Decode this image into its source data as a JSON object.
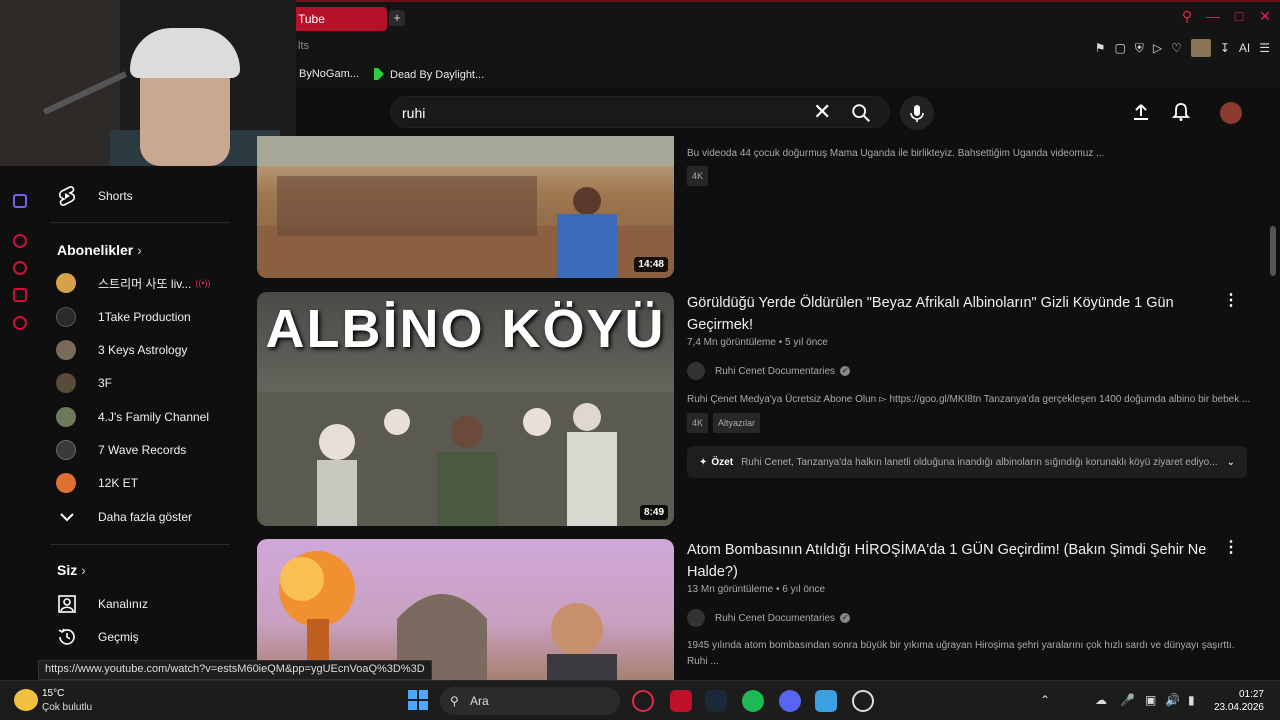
{
  "browser": {
    "tab_title": "Tube",
    "address_partial": "lts",
    "bookmarks": [
      "ByNoGam...",
      "Dead By Daylight..."
    ],
    "ai_label": "AI"
  },
  "youtube": {
    "search_value": "ruhi"
  },
  "sidebar": {
    "shorts_label": "Shorts",
    "subscriptions_header": "Abonelikler",
    "channels": [
      {
        "name": "스트리머 사또 liv...",
        "live": true,
        "color": "#d4a24a"
      },
      {
        "name": "1Take Production",
        "live": false,
        "color": "#2a2a2a"
      },
      {
        "name": "3 Keys Astrology",
        "live": false,
        "color": "#7a6a5a"
      },
      {
        "name": "3F",
        "live": false,
        "color": "#5a4a3a"
      },
      {
        "name": "4.J's Family Channel",
        "live": false,
        "color": "#6a7a5a"
      },
      {
        "name": "7 Wave Records",
        "live": false,
        "color": "#3a3a3a"
      },
      {
        "name": "12K ET",
        "live": false,
        "color": "#e07030"
      }
    ],
    "show_more_label": "Daha fazla göster",
    "you_header": "Siz",
    "your_channel_label": "Kanalınız",
    "history_label": "Geçmiş"
  },
  "videos": [
    {
      "duration": "14:48",
      "description": "Bu videoda 44 çocuk doğurmuş Mama Uganda ile birlikteyiz. Bahsettiğim Uganda videomuz ...",
      "badges": [
        "4K"
      ]
    },
    {
      "thumb_text": "ALBİNO KÖYÜ",
      "duration": "8:49",
      "title": "Görüldüğü Yerde Öldürülen \"Beyaz Afrikalı Albinoların\" Gizli Köyünde 1 Gün Geçirmek!",
      "views": "7,4 Mn görüntüleme",
      "age": "5 yıl önce",
      "channel": "Ruhi Cenet Documentaries",
      "description": "Ruhi Çenet Medya'ya Ücretsiz Abone Olun ▻ https://goo.gl/MKI8tn Tanzanya'da gerçekleşen 1400 doğumda albino bir bebek ...",
      "badges": [
        "4K",
        "Altyazılar"
      ],
      "summary_label": "Özet",
      "summary_text": "Ruhi Cenet, Tanzanya'da halkın lanetli olduğuna inandığı albinoların sığındığı korunaklı köyü ziyaret ediyo..."
    },
    {
      "duration": "",
      "title": "Atom Bombasının Atıldığı HİROŞİMA'da 1 GÜN Geçirdim! (Bakın Şimdi Şehir Ne Halde?)",
      "views": "13 Mn görüntüleme",
      "age": "6 yıl önce",
      "channel": "Ruhi Cenet Documentaries",
      "description_line1": "1945 yılında atom bombasından sonra büyük bir yıkıma uğrayan Hiroşima şehri yaralarını çok hızlı sardı ve dünyayı şaşırttı.",
      "description_line2": "Ruhi ..."
    }
  ],
  "status_url": "https://www.youtube.com/watch?v=estsM60ieQM&pp=ygUEcnVoaQ%3D%3D",
  "taskbar": {
    "weather_temp": "15°C",
    "weather_desc": "Çok bulutlu",
    "search_label": "Ara",
    "time": "01:27",
    "date": "23.04.2026"
  },
  "colors": {
    "accent": "#b5122a",
    "background": "#0f0f0f"
  }
}
